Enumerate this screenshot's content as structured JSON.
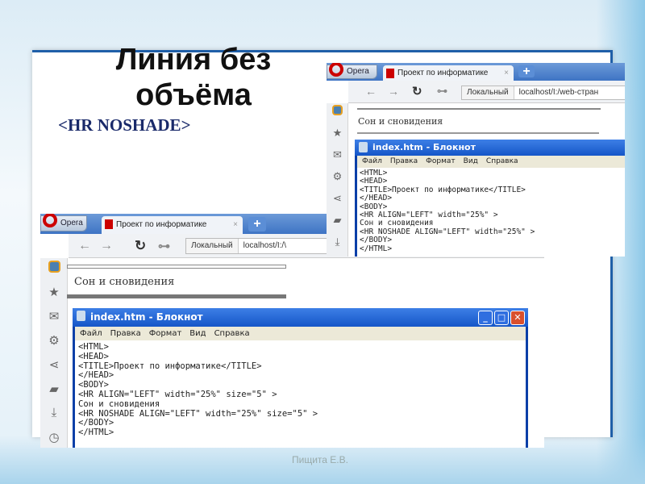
{
  "slide": {
    "title": "Линия без объёма",
    "subtitle": "<HR NOSHADE>",
    "footer": "Пищита Е.В."
  },
  "browser": {
    "opera_label": "Opera",
    "tab_title": "Проект по информатике",
    "tab_close": "×",
    "new_tab": "+",
    "back": "←",
    "forward": "→",
    "reload": "↻",
    "key": "⊶",
    "local_label": "Локальный",
    "url_right": "localhost/I:/web-стран",
    "url_bottom": "localhost/I:/\\",
    "page_text": "Сон и сновидения"
  },
  "notepad": {
    "title": "index.htm - Блокнот",
    "menu": [
      "Файл",
      "Правка",
      "Формат",
      "Вид",
      "Справка"
    ],
    "code_top": "<HTML>\n<HEAD>\n<TITLE>Проект по информатике</TITLE>\n</HEAD>\n<BODY>\n<HR ALIGN=\"LEFT\" width=\"25%\" >\nСон и сновидения\n<HR NOSHADE ALIGN=\"LEFT\" width=\"25%\" >\n</BODY>\n</HTML>",
    "code_bottom": "<HTML>\n<HEAD>\n<TITLE>Проект по информатике</TITLE>\n</HEAD>\n<BODY>\n<HR ALIGN=\"LEFT\" width=\"25%\" size=\"5\" >\nСон и сновидения\n<HR NOSHADE ALIGN=\"LEFT\" width=\"25%\" size=\"5\" >\n</BODY>\n</HTML>",
    "minimize": "_",
    "maximize": "□",
    "close": "✕"
  },
  "sidebar_icons": [
    "speed-dial",
    "★",
    "✉",
    "⚙",
    "⋖",
    "▰",
    "⤓",
    "◷"
  ]
}
